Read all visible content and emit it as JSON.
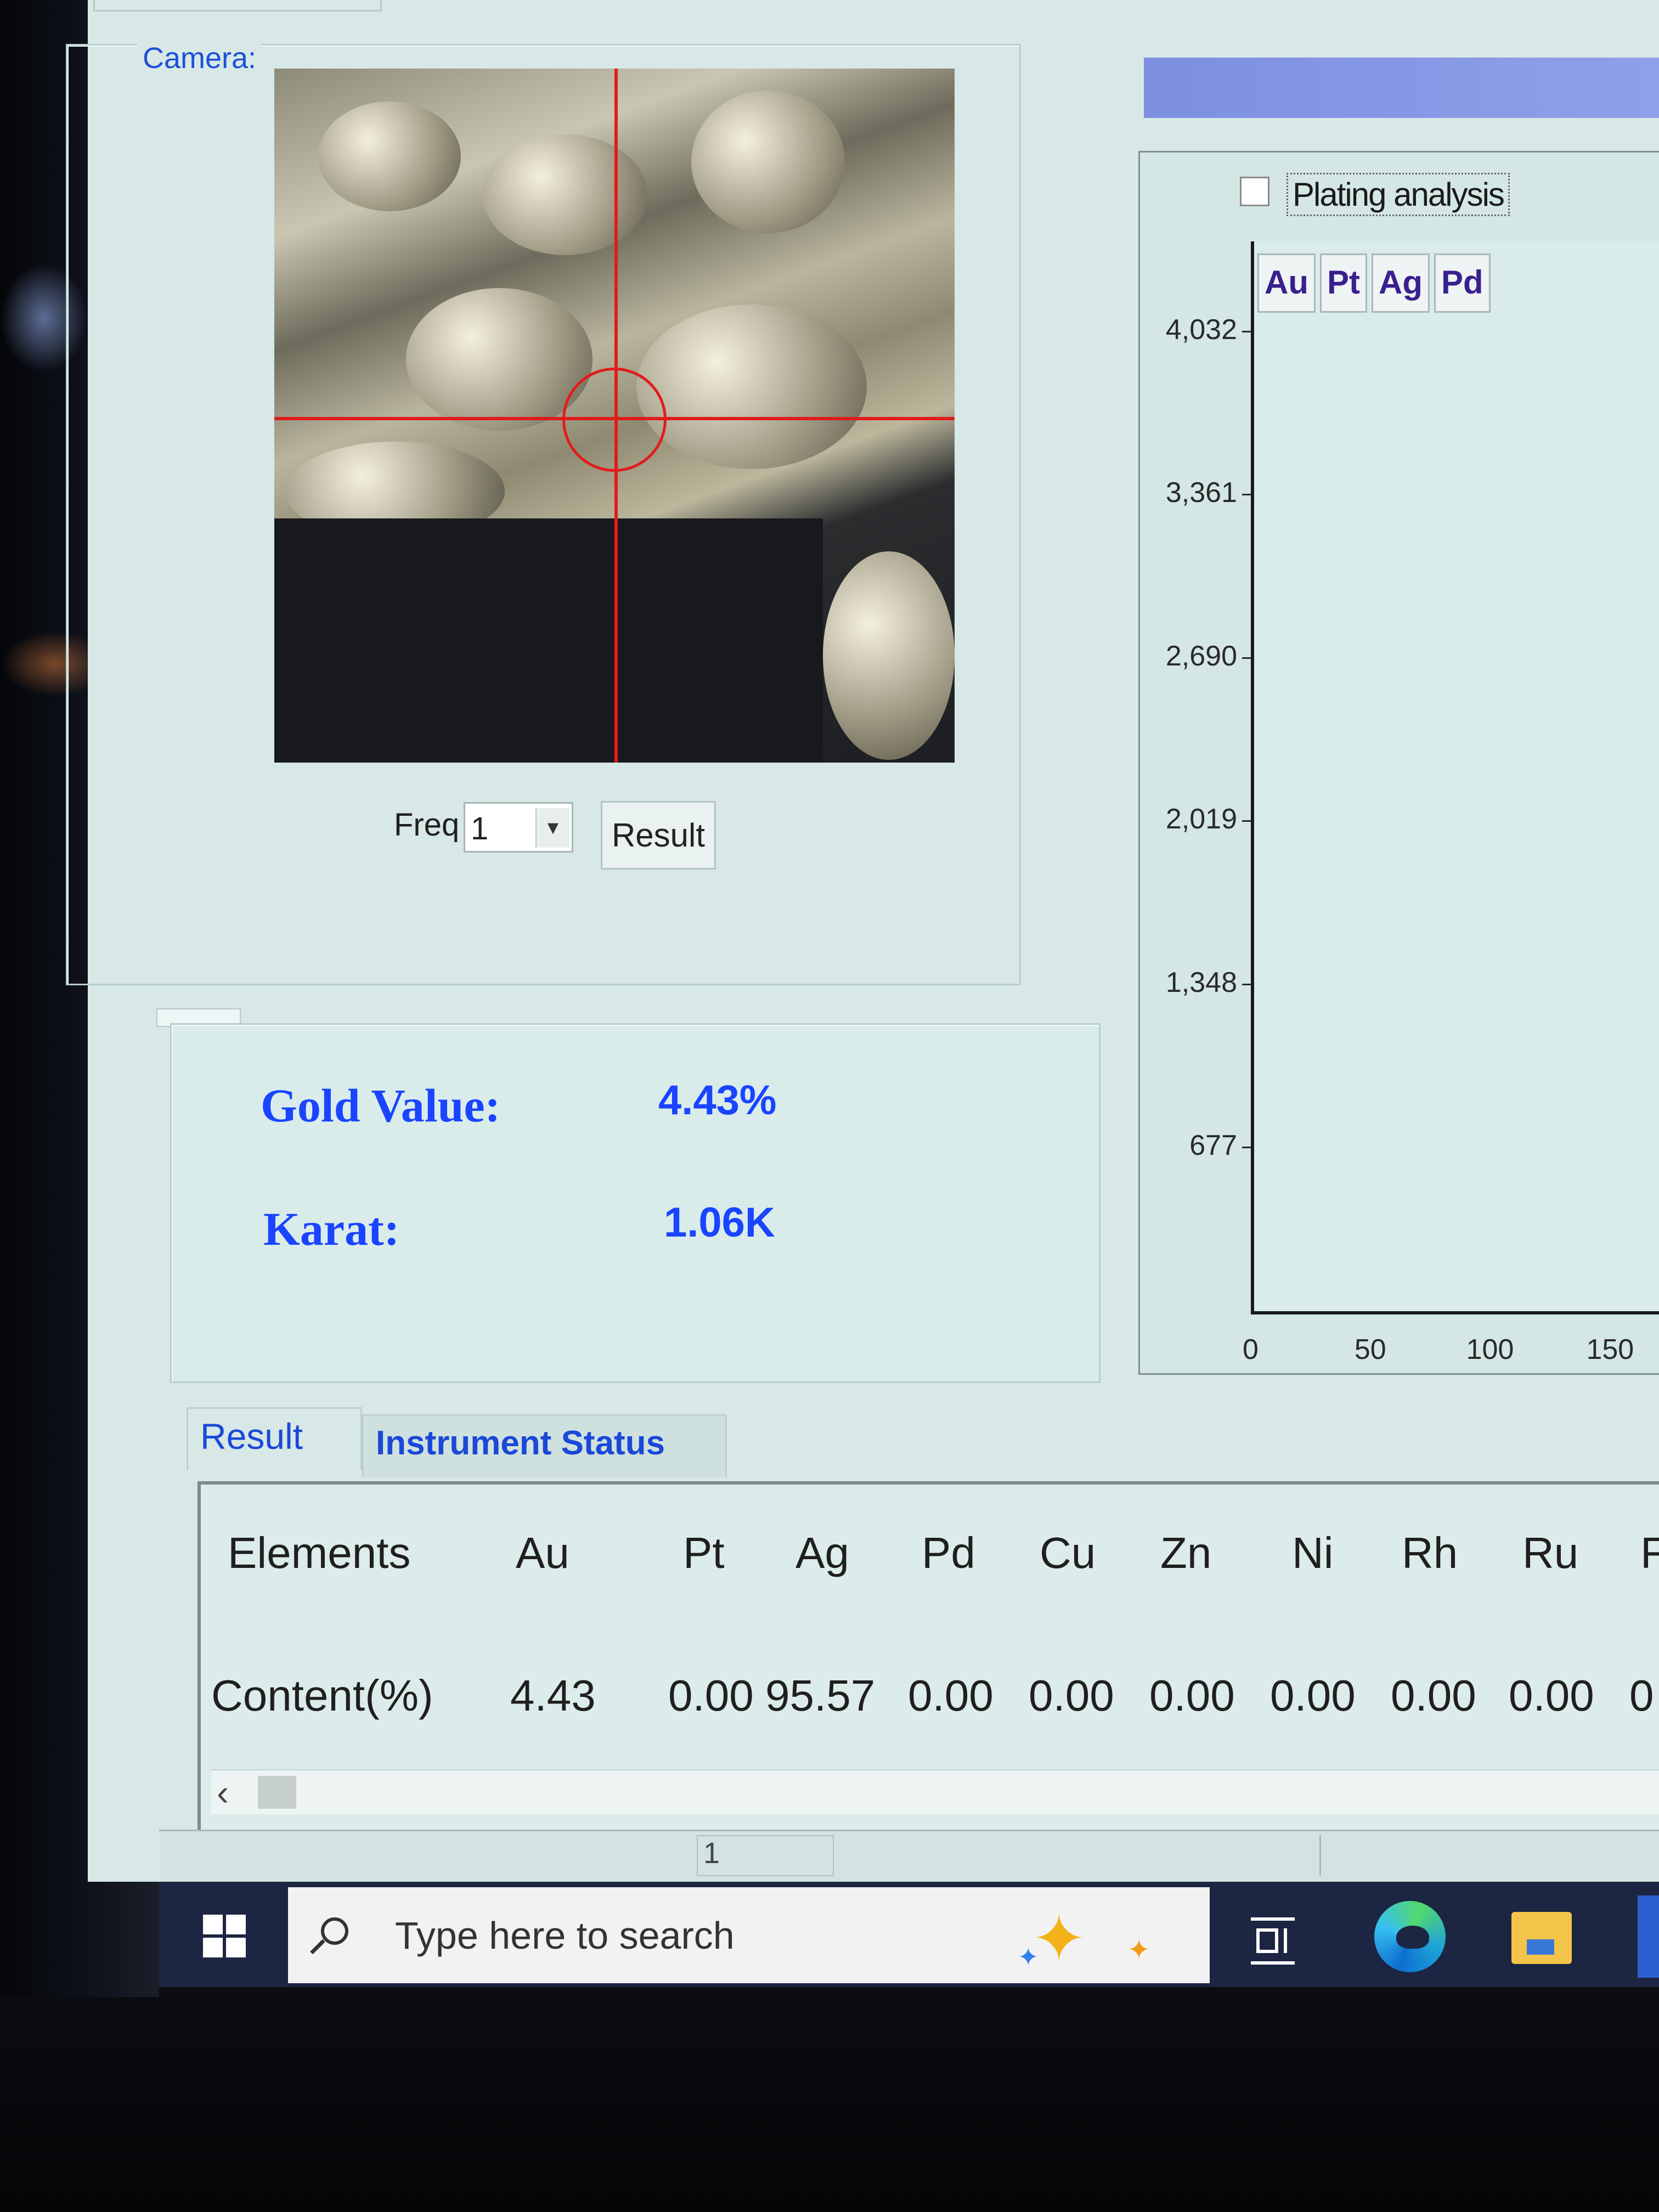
{
  "camera": {
    "legend": "Camera:",
    "freq_label": "Freq",
    "freq_value": "1",
    "result_button": "Result"
  },
  "gold": {
    "gold_value_label": "Gold Value:",
    "gold_value": "4.43%",
    "karat_label": "Karat:",
    "karat_value": "1.06K"
  },
  "chart": {
    "plating_analysis_label": "Plating analysis",
    "plating_analysis_checked": false,
    "element_buttons": [
      "Au",
      "Pt",
      "Ag",
      "Pd"
    ]
  },
  "chart_data": {
    "type": "line",
    "title": "",
    "xlabel": "",
    "ylabel": "",
    "x_ticks": [
      "0",
      "50",
      "100",
      "150"
    ],
    "y_ticks": [
      "4,032",
      "3,361",
      "2,690",
      "2,019",
      "1,348",
      "677"
    ],
    "xlim": [
      0,
      170
    ],
    "ylim": [
      0,
      4400
    ],
    "series": []
  },
  "tabs": [
    {
      "label": "Result",
      "active": true
    },
    {
      "label": "Instrument Status",
      "active": false
    }
  ],
  "results_table": {
    "row_header_elements": "Elements",
    "row_header_content": "Content(%)",
    "elements": [
      "Au",
      "Pt",
      "Ag",
      "Pd",
      "Cu",
      "Zn",
      "Ni",
      "Rh",
      "Ru",
      "F"
    ],
    "content": [
      "4.43",
      "0.00",
      "95.57",
      "0.00",
      "0.00",
      "0.00",
      "0.00",
      "0.00",
      "0.00",
      "0"
    ]
  },
  "statusbar": {
    "cell_1": "1"
  },
  "taskbar": {
    "search_placeholder": "Type here to search"
  }
}
